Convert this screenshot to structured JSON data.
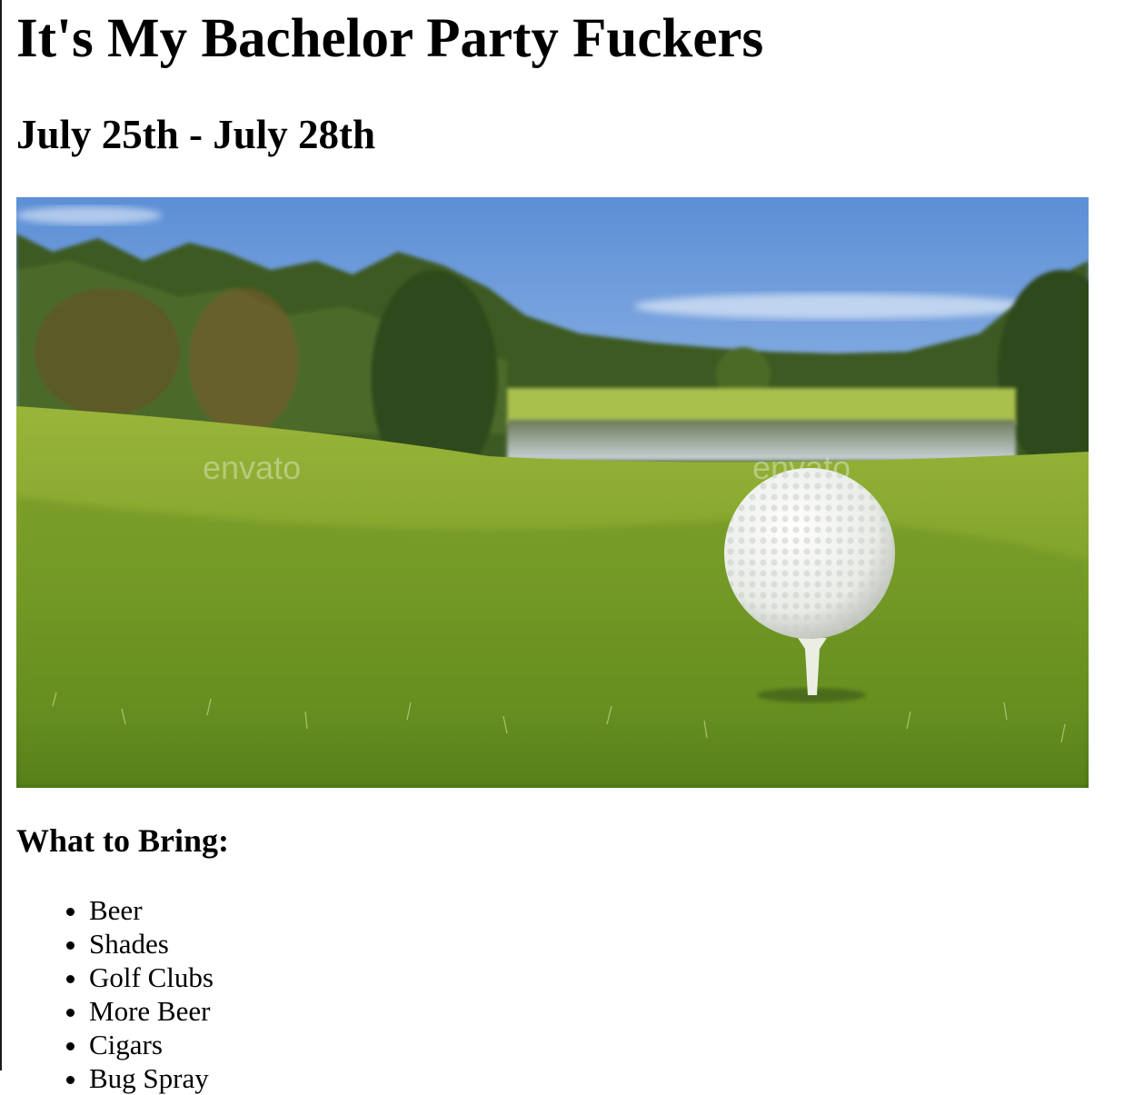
{
  "page": {
    "title": "It's My Bachelor Party Fuckers",
    "dates": "July 25th - July 28th",
    "hero_image": {
      "subject": "golf ball on tee at golf course with pond and trees",
      "watermark_text": "envato"
    },
    "bring_heading": "What to Bring:",
    "bring_items": [
      "Beer",
      "Shades",
      "Golf Clubs",
      "More Beer",
      "Cigars",
      "Bug Spray"
    ]
  }
}
